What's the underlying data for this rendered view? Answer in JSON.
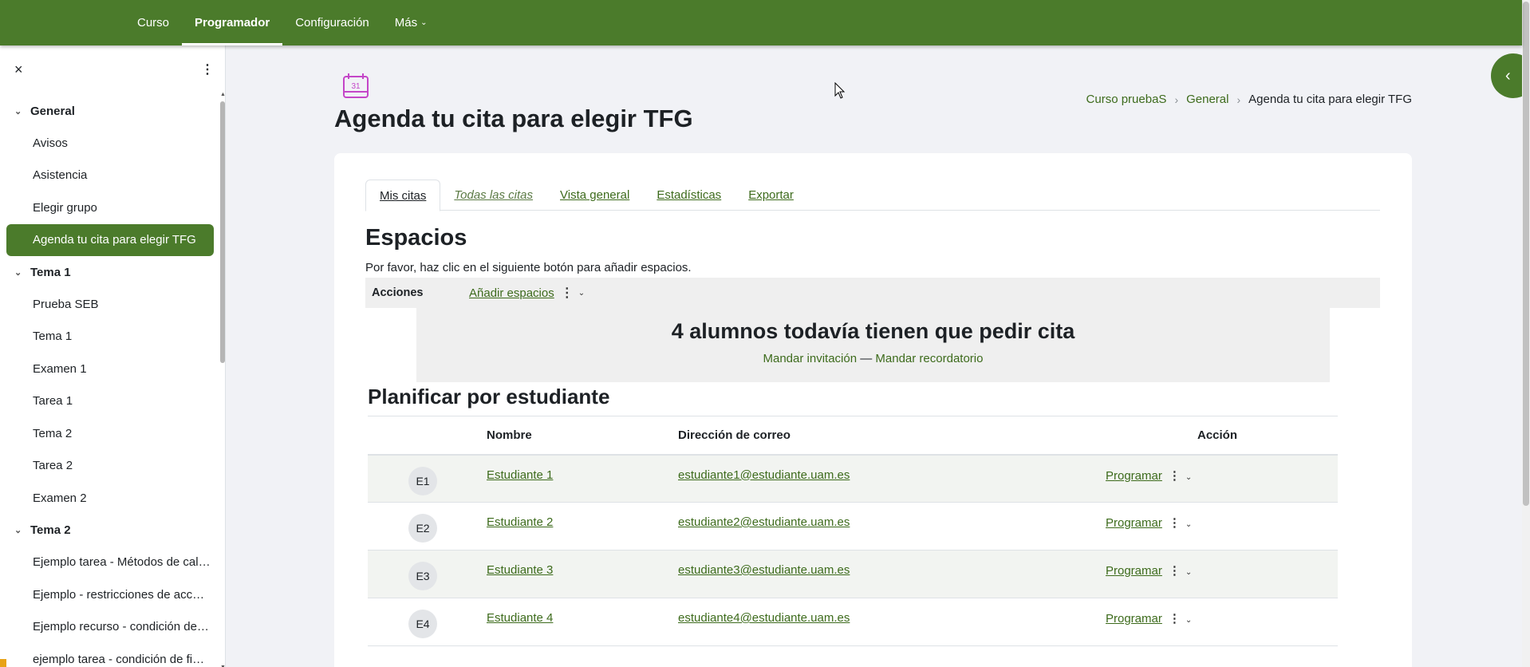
{
  "topnav": {
    "tabs": [
      {
        "label": "Curso"
      },
      {
        "label": "Programador"
      },
      {
        "label": "Configuración"
      },
      {
        "label": "Más"
      }
    ]
  },
  "sidebar": {
    "close_icon": "×",
    "kebab_icon": "⋮",
    "sections": [
      {
        "label": "General",
        "items": [
          "Avisos",
          "Asistencia",
          "Elegir grupo",
          "Agenda tu cita para elegir TFG"
        ]
      },
      {
        "label": "Tema 1",
        "items": [
          "Prueba SEB",
          "Tema 1",
          "Examen 1",
          "Tarea 1",
          "Tema 2",
          "Tarea 2",
          "Examen 2"
        ]
      },
      {
        "label": "Tema 2",
        "items": [
          "Ejemplo tarea - Métodos de cal…",
          "Ejemplo - restricciones de acc…",
          "Ejemplo recurso - condición de…",
          "ejemplo tarea - condición de fi…"
        ]
      }
    ],
    "active_item": "Agenda tu cita para elegir TFG"
  },
  "page": {
    "icon": "calendar-icon",
    "icon_day": "31",
    "title": "Agenda tu cita para elegir TFG",
    "breadcrumb": [
      "Curso pruebaS",
      "General",
      "Agenda tu cita para elegir TFG"
    ]
  },
  "tabs": [
    "Mis citas",
    "Todas las citas",
    "Vista general",
    "Estadísticas",
    "Exportar"
  ],
  "slots": {
    "heading": "Espacios",
    "hint": "Por favor, haz clic en el siguiente botón para añadir espacios.",
    "actions_label": "Acciones",
    "add_label": "Añadir espacios"
  },
  "notice": {
    "message": "4 alumnos todavía tienen que pedir cita",
    "invite": "Mandar invitación",
    "dash": "—",
    "reminder": "Mandar recordatorio"
  },
  "schedule": {
    "heading": "Planificar por estudiante",
    "columns": [
      "",
      "Nombre",
      "Dirección de correo",
      "Acción"
    ],
    "rows": [
      {
        "initials": "E1",
        "name": "Estudiante 1",
        "email": "estudiante1@estudiante.uam.es",
        "action": "Programar"
      },
      {
        "initials": "E2",
        "name": "Estudiante 2",
        "email": "estudiante2@estudiante.uam.es",
        "action": "Programar"
      },
      {
        "initials": "E3",
        "name": "Estudiante 3",
        "email": "estudiante3@estudiante.uam.es",
        "action": "Programar"
      },
      {
        "initials": "E4",
        "name": "Estudiante 4",
        "email": "estudiante4@estudiante.uam.es",
        "action": "Programar"
      }
    ]
  },
  "colors": {
    "brand": "#4b7b2b",
    "link": "#3d6b1c",
    "background": "#f1f2f6",
    "icon_accent": "#c446c8"
  }
}
